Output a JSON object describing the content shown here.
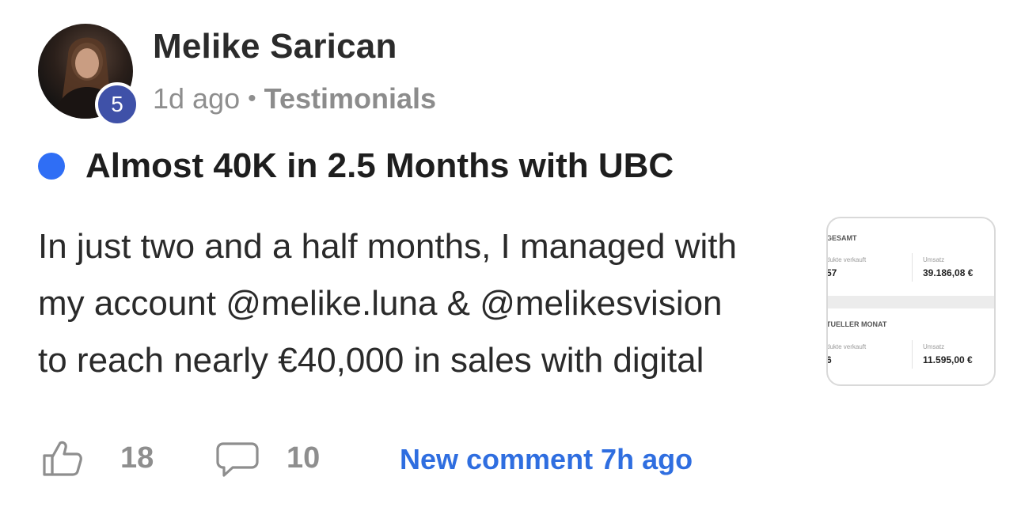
{
  "author": {
    "name": "Melike Sarican",
    "level": "5"
  },
  "meta": {
    "time": "1d ago",
    "separator": "•",
    "category": "Testimonials"
  },
  "post": {
    "title": "Almost 40K in 2.5 Months with UBC",
    "body_lines": [
      "In just two and a half months, I managed with",
      "my account @melike.luna & @melikesvision",
      "to reach nearly €40,000 in sales with digital"
    ]
  },
  "thumbnail": {
    "section1": {
      "title": "GESAMT",
      "left_label": "dukte verkauft",
      "left_value": "57",
      "right_label": "Umsatz",
      "right_value": "39.186,08 €"
    },
    "section2": {
      "title": "TUELLER MONAT",
      "left_label": "dukte verkauft",
      "left_value": "6",
      "right_label": "Umsatz",
      "right_value": "11.595,00 €"
    }
  },
  "footer": {
    "like_icon": "thumbs-up-icon",
    "likes": "18",
    "comment_icon": "speech-bubble-icon",
    "comments": "10",
    "new_comment": "New comment 7h ago"
  },
  "colors": {
    "accent": "#2f6ef5",
    "level_badge": "#3f51a8",
    "link": "#2f6ee0",
    "muted": "#8e8e8e"
  }
}
